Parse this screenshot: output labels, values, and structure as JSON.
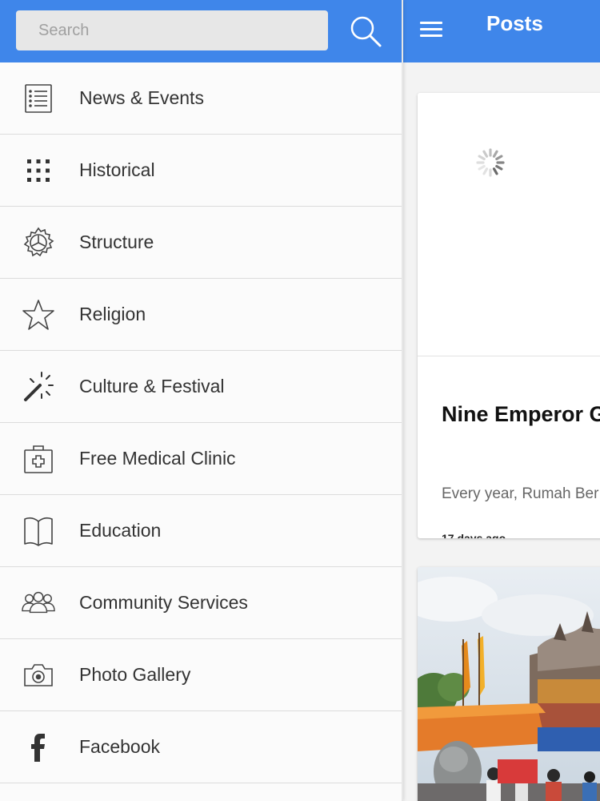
{
  "drawer": {
    "search": {
      "placeholder": "Search",
      "value": ""
    },
    "items": [
      {
        "label": "News & Events",
        "icon": "list-icon"
      },
      {
        "label": "Historical",
        "icon": "grid-dots-icon"
      },
      {
        "label": "Structure",
        "icon": "gear-icon"
      },
      {
        "label": "Religion",
        "icon": "star-icon"
      },
      {
        "label": "Culture & Festival",
        "icon": "magic-wand-icon"
      },
      {
        "label": "Free Medical Clinic",
        "icon": "medical-kit-icon"
      },
      {
        "label": "Education",
        "icon": "book-icon"
      },
      {
        "label": "Community Services",
        "icon": "people-icon"
      },
      {
        "label": "Photo Gallery",
        "icon": "camera-icon"
      },
      {
        "label": "Facebook",
        "icon": "facebook-icon"
      }
    ]
  },
  "toolbar": {
    "title": "Posts"
  },
  "posts": [
    {
      "title": "Nine Emperor G",
      "excerpt": "Every year, Rumah Ber",
      "time": "17 days ago",
      "media": "loading-spinner"
    },
    {
      "media": "temple-festival-photo"
    }
  ],
  "colors": {
    "accent": "#3f86ea",
    "drawer_bg": "#fbfbfb",
    "divider": "#dcdcdc",
    "label_text": "#333333"
  }
}
